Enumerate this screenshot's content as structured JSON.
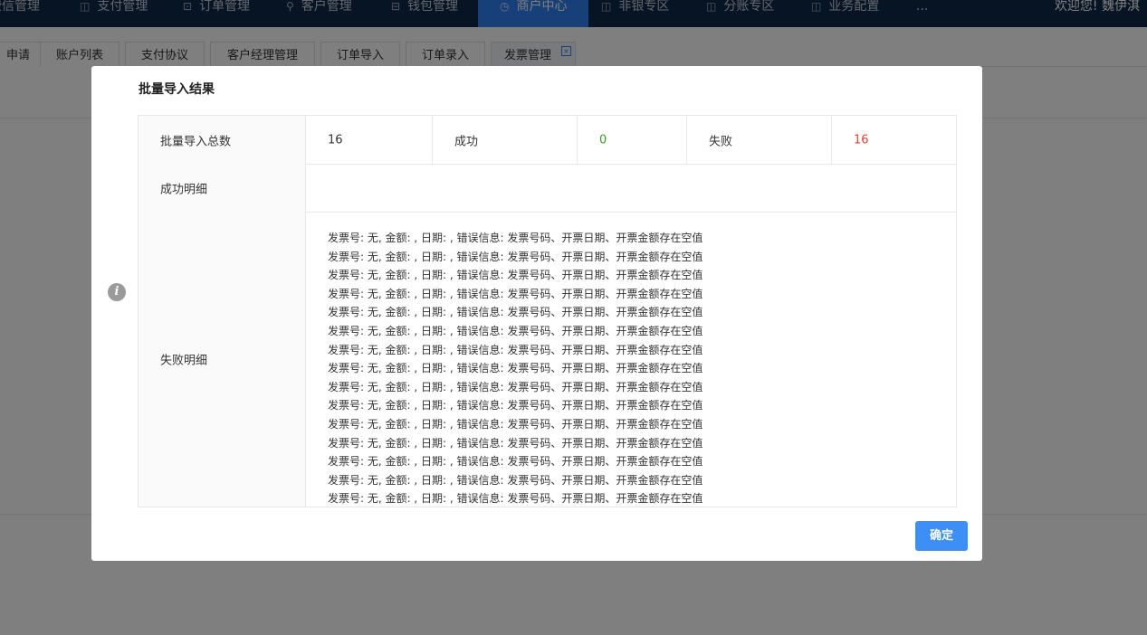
{
  "nav": {
    "items": [
      {
        "label": "授信管理",
        "icon": "doc-icon"
      },
      {
        "label": "支付管理",
        "icon": "doc-icon"
      },
      {
        "label": "订单管理",
        "icon": "cart-icon"
      },
      {
        "label": "客户管理",
        "icon": "user-icon"
      },
      {
        "label": "钱包管理",
        "icon": "wallet-icon"
      },
      {
        "label": "商户中心",
        "icon": "clock-icon"
      },
      {
        "label": "非银专区",
        "icon": "doc-icon"
      },
      {
        "label": "分账专区",
        "icon": "doc-icon"
      },
      {
        "label": "业务配置",
        "icon": "doc-icon"
      },
      {
        "label": "...",
        "icon": ""
      }
    ],
    "welcome": "欢迎您! 魏伊淇",
    "colors": {
      "background": "#0f2948",
      "active": "#2f7ff0"
    }
  },
  "tabs": [
    "申请",
    "账户列表",
    "支付协议",
    "客户经理管理",
    "订单导入",
    "订单录入",
    "发票管理"
  ],
  "tabs_close": "×",
  "modal": {
    "title": "批量导入结果",
    "summary": {
      "total_label": "批量导入总数",
      "total_value": "16",
      "success_label": "成功",
      "success_value": "0",
      "fail_label": "失败",
      "fail_value": "16"
    },
    "success_detail_label": "成功明细",
    "fail_detail_label": "失败明细",
    "fail_lines": [
      "发票号: 无, 金额: , 日期: , 错误信息: 发票号码、开票日期、开票金额存在空值",
      "发票号: 无, 金额: , 日期: , 错误信息: 发票号码、开票日期、开票金额存在空值",
      "发票号: 无, 金额: , 日期: , 错误信息: 发票号码、开票日期、开票金额存在空值",
      "发票号: 无, 金额: , 日期: , 错误信息: 发票号码、开票日期、开票金额存在空值",
      "发票号: 无, 金额: , 日期: , 错误信息: 发票号码、开票日期、开票金额存在空值",
      "发票号: 无, 金额: , 日期: , 错误信息: 发票号码、开票日期、开票金额存在空值",
      "发票号: 无, 金额: , 日期: , 错误信息: 发票号码、开票日期、开票金额存在空值",
      "发票号: 无, 金额: , 日期: , 错误信息: 发票号码、开票日期、开票金额存在空值",
      "发票号: 无, 金额: , 日期: , 错误信息: 发票号码、开票日期、开票金额存在空值",
      "发票号: 无, 金额: , 日期: , 错误信息: 发票号码、开票日期、开票金额存在空值",
      "发票号: 无, 金额: , 日期: , 错误信息: 发票号码、开票日期、开票金额存在空值",
      "发票号: 无, 金额: , 日期: , 错误信息: 发票号码、开票日期、开票金额存在空值",
      "发票号: 无, 金额: , 日期: , 错误信息: 发票号码、开票日期、开票金额存在空值",
      "发票号: 无, 金额: , 日期: , 错误信息: 发票号码、开票日期、开票金额存在空值",
      "发票号: 无, 金额: , 日期: , 错误信息: 发票号码、开票日期、开票金额存在空值"
    ],
    "confirm_label": "确定",
    "colors": {
      "success": "#3a9d23",
      "fail": "#e5432f",
      "button": "#3d8ff5"
    }
  }
}
